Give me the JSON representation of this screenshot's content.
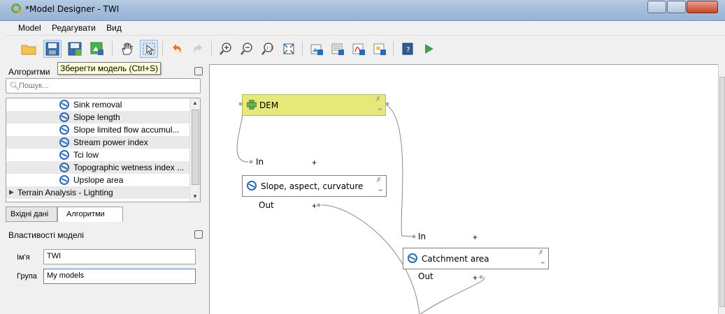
{
  "window": {
    "title": "*Model Designer - TWI"
  },
  "menu": {
    "model": "Model",
    "edit": "Редагувати",
    "view": "Вид"
  },
  "tooltip": {
    "text": "Зберегти модель (Ctrl+S)"
  },
  "algorithms_panel": {
    "title": "Алгоритми",
    "search": {
      "placeholder": "Пошук..."
    },
    "items": [
      {
        "label": "Sink removal"
      },
      {
        "label": "Slope length"
      },
      {
        "label": "Slope limited flow accumul..."
      },
      {
        "label": "Stream power index"
      },
      {
        "label": "Tci low"
      },
      {
        "label": "Topographic wetness index ..."
      },
      {
        "label": "Upslope area"
      }
    ],
    "category": {
      "label": "Terrain Analysis - Lighting"
    }
  },
  "tabs": {
    "inputs": "Вхідні дані",
    "algorithms": "Алгоритми"
  },
  "properties": {
    "title": "Властивості моделі",
    "name_label": "Ім'я",
    "name_value": "TWI",
    "group_label": "Група",
    "group_value": "My models"
  },
  "model": {
    "dem": {
      "label": "DEM"
    },
    "slope": {
      "label": "Slope, aspect, curvature",
      "in": "In",
      "out": "Out"
    },
    "catchment": {
      "label": "Catchment area",
      "in": "In",
      "out": "Out"
    },
    "plus": "+"
  },
  "colors": {
    "input_node": "#e6e879",
    "accent": "#3c8cd8"
  }
}
